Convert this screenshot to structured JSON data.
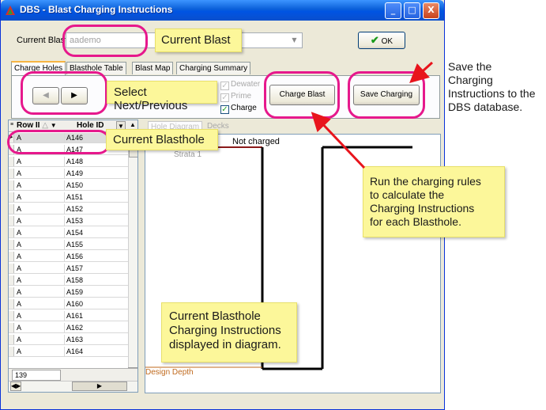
{
  "window": {
    "title": "DBS - Blast Charging Instructions",
    "minimize_glyph": "_",
    "maximize_glyph": "□",
    "close_glyph": "X"
  },
  "header": {
    "current_blast_label": "Current Blast :",
    "current_blast_value": "aademo",
    "ok_label": "OK"
  },
  "tabs": [
    "Charge Holes",
    "Blasthole Table",
    "Blast Map",
    "Charging Summary"
  ],
  "toolbar": {
    "prev_glyph": "◀",
    "next_glyph": "▶",
    "dewater_label": "Dewater",
    "prime_label": "Prime",
    "charge_label": "Charge",
    "charge_blast_label": "Charge Blast",
    "save_charging_label": "Save Charging"
  },
  "grid": {
    "col_row": "Row II",
    "col_hole": "Hole ID",
    "rows": [
      {
        "row": "A",
        "hole": "A146"
      },
      {
        "row": "A",
        "hole": "A147"
      },
      {
        "row": "A",
        "hole": "A148"
      },
      {
        "row": "A",
        "hole": "A149"
      },
      {
        "row": "A",
        "hole": "A150"
      },
      {
        "row": "A",
        "hole": "A151"
      },
      {
        "row": "A",
        "hole": "A152"
      },
      {
        "row": "A",
        "hole": "A153"
      },
      {
        "row": "A",
        "hole": "A154"
      },
      {
        "row": "A",
        "hole": "A155"
      },
      {
        "row": "A",
        "hole": "A156"
      },
      {
        "row": "A",
        "hole": "A157"
      },
      {
        "row": "A",
        "hole": "A158"
      },
      {
        "row": "A",
        "hole": "A159"
      },
      {
        "row": "A",
        "hole": "A160"
      },
      {
        "row": "A",
        "hole": "A161"
      },
      {
        "row": "A",
        "hole": "A162"
      },
      {
        "row": "A",
        "hole": "A163"
      },
      {
        "row": "A",
        "hole": "A164"
      }
    ],
    "record_count": "139"
  },
  "diagram": {
    "tab_diagram": "Hole Diagram",
    "tab_decks": "Decks",
    "status_text": "Not charged",
    "strata_label": "Strata 1",
    "design_depth_label": "Design Depth"
  },
  "callouts": {
    "current_blast": "Current Blast",
    "select_next_previous": "Select Next/Previous",
    "current_blasthole": "Current Blasthole",
    "save_charging_lines": [
      "Save the",
      "Charging",
      "Instructions to the",
      "DBS database."
    ],
    "run_rules_lines": [
      "Run the charging rules",
      "to calculate the",
      "Charging Instructions",
      "for each Blasthole."
    ],
    "diagram_lines": [
      "Current Blasthole",
      "Charging Instructions",
      "displayed in diagram."
    ]
  },
  "colors": {
    "title_bar": "#0054e3",
    "callout_fill": "#fcf79a",
    "highlight_ring": "#e6188c",
    "arrow": "#e8141c",
    "design_depth": "#c06a1e"
  }
}
